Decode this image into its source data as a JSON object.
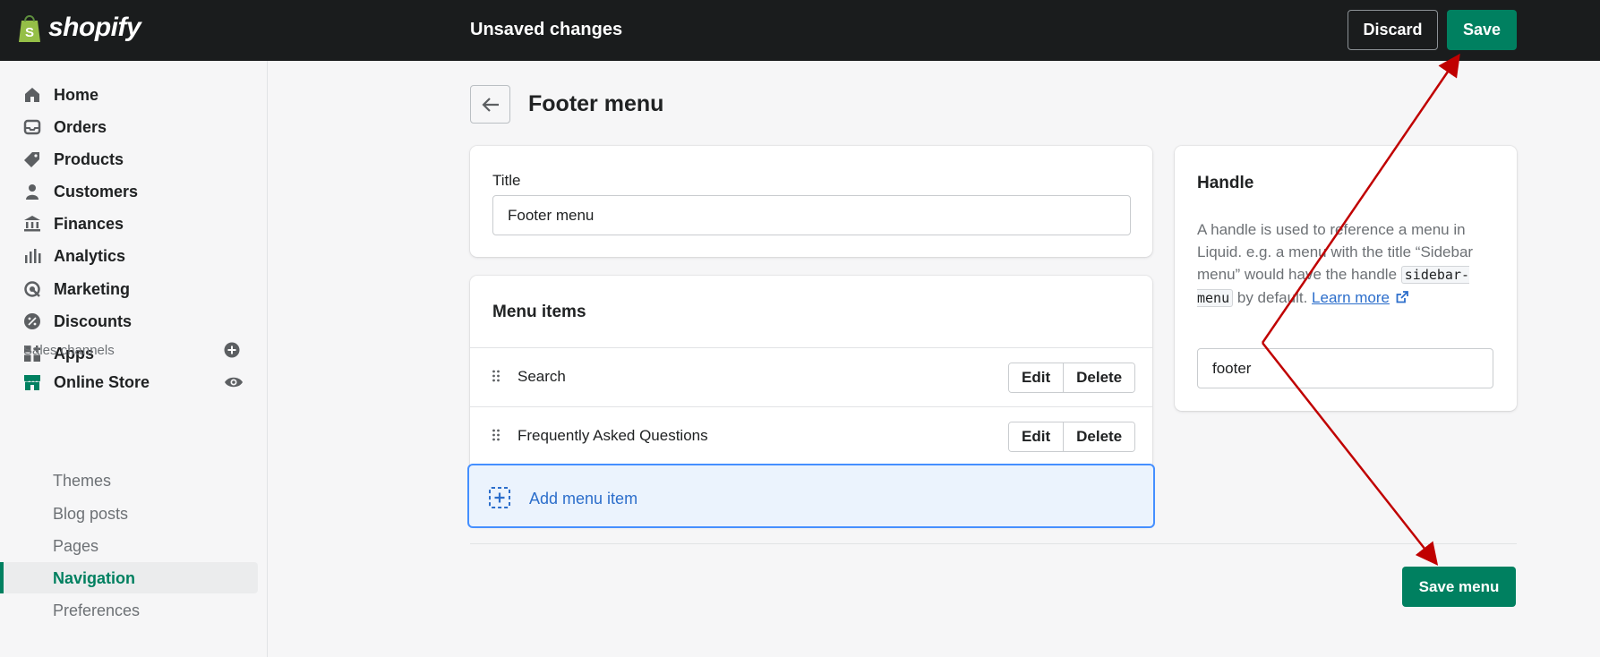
{
  "app": {
    "logo_text": "shopify"
  },
  "topbar": {
    "status": "Unsaved changes",
    "discard_label": "Discard",
    "save_label": "Save"
  },
  "sidebar": {
    "items": [
      {
        "label": "Home",
        "icon": "home-icon"
      },
      {
        "label": "Orders",
        "icon": "orders-icon"
      },
      {
        "label": "Products",
        "icon": "tag-icon"
      },
      {
        "label": "Customers",
        "icon": "person-icon"
      },
      {
        "label": "Finances",
        "icon": "bank-icon"
      },
      {
        "label": "Analytics",
        "icon": "bar-chart-icon"
      },
      {
        "label": "Marketing",
        "icon": "target-icon"
      },
      {
        "label": "Discounts",
        "icon": "discount-icon"
      },
      {
        "label": "Apps",
        "icon": "apps-icon"
      }
    ],
    "sales_channels_label": "Sales channels",
    "online_store_label": "Online Store",
    "online_store_subitems": [
      "Themes",
      "Blog posts",
      "Pages",
      "Navigation",
      "Preferences"
    ],
    "active_subitem": "Navigation"
  },
  "page": {
    "title": "Footer menu"
  },
  "title_card": {
    "label": "Title",
    "value": "Footer menu"
  },
  "menu_items_card": {
    "heading": "Menu items",
    "items": [
      {
        "label": "Search",
        "edit": "Edit",
        "delete": "Delete"
      },
      {
        "label": "Frequently Asked Questions",
        "edit": "Edit",
        "delete": "Delete"
      }
    ],
    "add_label": "Add menu item"
  },
  "handle_card": {
    "title": "Handle",
    "desc_part1": "A handle is used to reference a menu in Liquid. e.g. a menu with the title “Sidebar menu” would have the handle",
    "code": "sidebar-menu",
    "desc_part2": "by default.",
    "learn_more": "Learn more",
    "value": "footer"
  },
  "footer": {
    "save_menu_label": "Save menu"
  },
  "colors": {
    "primary": "#008060",
    "topbar": "#1a1c1d",
    "link": "#2c6ecb",
    "annotation_arrow": "#c00000"
  }
}
